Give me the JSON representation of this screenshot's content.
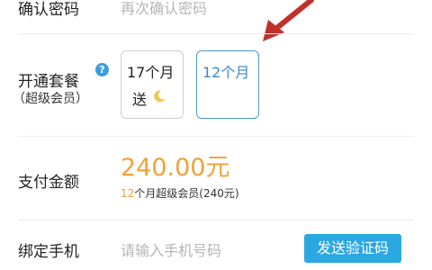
{
  "confirm_password": {
    "label": "确认密码",
    "placeholder": "再次确认密码"
  },
  "plan": {
    "label": "开通套餐",
    "sublabel": "（超级会员）",
    "help_icon": "question-circle-icon",
    "options": [
      {
        "line1": "17个月",
        "line2": "送",
        "icon": "moon-icon",
        "selected": false
      },
      {
        "line1": "12个月",
        "selected": true
      }
    ]
  },
  "payment": {
    "label": "支付金额",
    "amount": "240.00元",
    "detail_highlight": "12",
    "detail_rest": "个月超级会员(240元)"
  },
  "phone": {
    "label": "绑定手机",
    "placeholder": "请输入手机号码",
    "send_button": "发送验证码"
  },
  "colors": {
    "accent": "#f0a23a",
    "button": "#2ba7e2",
    "selected_border": "#4a97d6",
    "arrow": "#c0312b"
  }
}
